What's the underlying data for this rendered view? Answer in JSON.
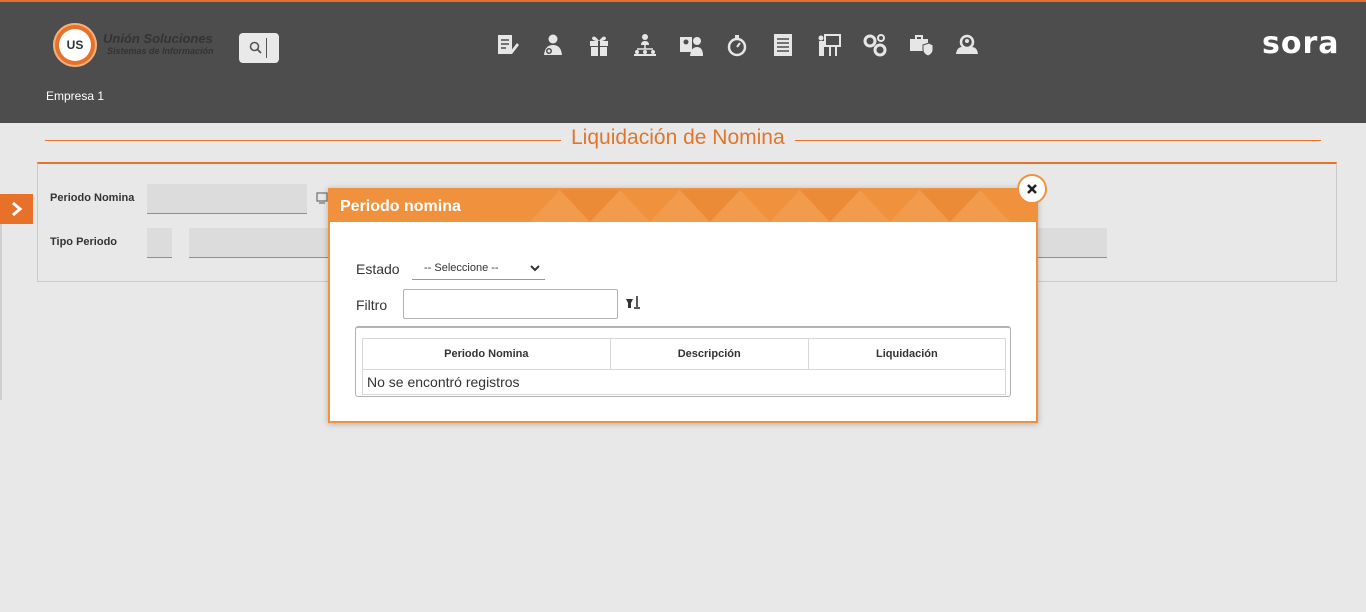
{
  "header": {
    "logo_mark": "US",
    "logo_title": "Unión Soluciones",
    "logo_subtitle": "Sistemas de Información",
    "brand": "sora",
    "company": "Empresa 1",
    "nav_icons": [
      "document-edit-icon",
      "user-settings-icon",
      "gift-icon",
      "org-chart-icon",
      "id-card-user-icon",
      "stopwatch-icon",
      "document-list-icon",
      "presentation-icon",
      "gears-icon",
      "briefcase-shield-icon",
      "users-search-icon"
    ]
  },
  "page": {
    "title": "Liquidación de Nomina"
  },
  "form": {
    "periodo_label": "Periodo Nomina",
    "tipo_label": "Tipo Periodo"
  },
  "modal": {
    "title": "Periodo nomina",
    "estado_label": "Estado",
    "estado_selected": "-- Seleccione --",
    "filtro_label": "Filtro",
    "filtro_value": "",
    "columns": [
      "Periodo Nomina",
      "Descripción",
      "Liquidación"
    ],
    "empty_message": "No se encontró registros"
  },
  "colors": {
    "accent": "#e8712a",
    "header_bg": "#4d4d4d",
    "modal_header": "#f0923d"
  }
}
